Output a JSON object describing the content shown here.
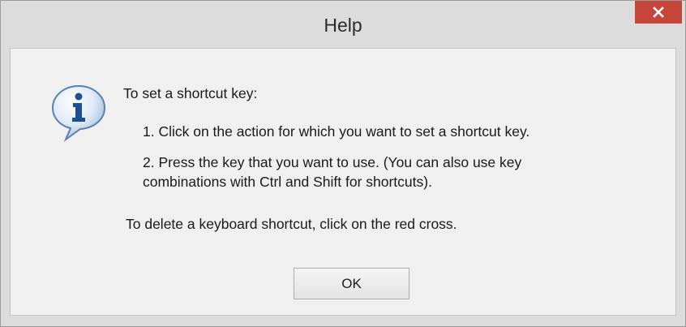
{
  "window": {
    "title": "Help",
    "close_icon": "close-icon",
    "close_color": "#c7463a"
  },
  "message": {
    "icon": "info-icon",
    "heading": "To set a shortcut key:",
    "step1": "1. Click on the action for which you want to set a shortcut key.",
    "step2_line1": "2. Press the key that you want to use.  (You can also use key",
    "step2_line2": "combinations with Ctrl and Shift for shortcuts).",
    "delete_note": "To delete a keyboard shortcut, click on the red cross."
  },
  "buttons": {
    "ok_label": "OK"
  }
}
